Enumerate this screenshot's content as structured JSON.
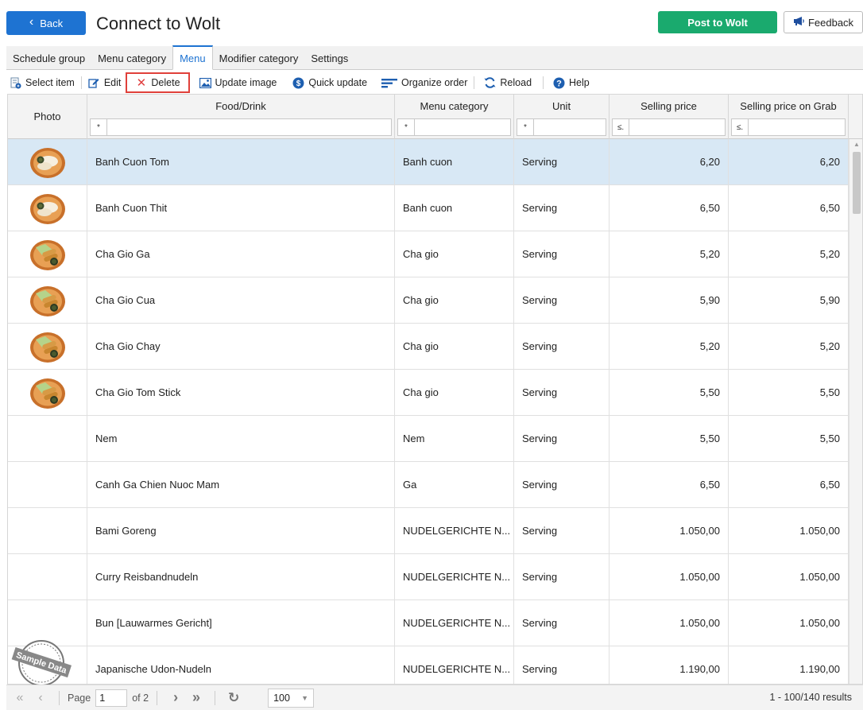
{
  "header": {
    "back_label": "Back",
    "title": "Connect to Wolt",
    "post_label": "Post to Wolt",
    "feedback_label": "Feedback"
  },
  "tabs": [
    {
      "label": "Schedule group",
      "active": false
    },
    {
      "label": "Menu category",
      "active": false
    },
    {
      "label": "Menu",
      "active": true
    },
    {
      "label": "Modifier category",
      "active": false
    },
    {
      "label": "Settings",
      "active": false
    }
  ],
  "toolbar": {
    "select_item": "Select item",
    "edit": "Edit",
    "delete": "Delete",
    "update_image": "Update image",
    "quick_update": "Quick update",
    "organize_order": "Organize order",
    "reload": "Reload",
    "help": "Help"
  },
  "columns": {
    "photo": "Photo",
    "food": "Food/Drink",
    "category": "Menu category",
    "unit": "Unit",
    "price": "Selling price",
    "price_grab": "Selling price on Grab"
  },
  "filters": {
    "food_op": "*",
    "category_op": "*",
    "unit_op": "*",
    "price_op": "≤.",
    "price_grab_op": "≤."
  },
  "rows": [
    {
      "food": "Banh Cuon Tom",
      "category": "Banh cuon",
      "unit": "Serving",
      "price": "6,20",
      "price_grab": "6,20",
      "photo": true,
      "selected": true
    },
    {
      "food": "Banh Cuon Thit",
      "category": "Banh cuon",
      "unit": "Serving",
      "price": "6,50",
      "price_grab": "6,50",
      "photo": true,
      "selected": false
    },
    {
      "food": "Cha Gio Ga",
      "category": "Cha gio",
      "unit": "Serving",
      "price": "5,20",
      "price_grab": "5,20",
      "photo": true,
      "selected": false
    },
    {
      "food": "Cha Gio Cua",
      "category": "Cha gio",
      "unit": "Serving",
      "price": "5,90",
      "price_grab": "5,90",
      "photo": true,
      "selected": false
    },
    {
      "food": "Cha Gio Chay",
      "category": "Cha gio",
      "unit": "Serving",
      "price": "5,20",
      "price_grab": "5,20",
      "photo": true,
      "selected": false
    },
    {
      "food": "Cha Gio Tom Stick",
      "category": "Cha gio",
      "unit": "Serving",
      "price": "5,50",
      "price_grab": "5,50",
      "photo": true,
      "selected": false
    },
    {
      "food": "Nem",
      "category": "Nem",
      "unit": "Serving",
      "price": "5,50",
      "price_grab": "5,50",
      "photo": false,
      "selected": false
    },
    {
      "food": "Canh Ga Chien Nuoc Mam",
      "category": "Ga",
      "unit": "Serving",
      "price": "6,50",
      "price_grab": "6,50",
      "photo": false,
      "selected": false
    },
    {
      "food": "Bami Goreng",
      "category": "NUDELGERICHTE N...",
      "unit": "Serving",
      "price": "1.050,00",
      "price_grab": "1.050,00",
      "photo": false,
      "selected": false
    },
    {
      "food": "Curry Reisbandnudeln",
      "category": "NUDELGERICHTE N...",
      "unit": "Serving",
      "price": "1.050,00",
      "price_grab": "1.050,00",
      "photo": false,
      "selected": false
    },
    {
      "food": "Bun [Lauwarmes Gericht]",
      "category": "NUDELGERICHTE N...",
      "unit": "Serving",
      "price": "1.050,00",
      "price_grab": "1.050,00",
      "photo": false,
      "selected": false
    },
    {
      "food": "Japanische Udon-Nudeln",
      "category": "NUDELGERICHTE N...",
      "unit": "Serving",
      "price": "1.190,00",
      "price_grab": "1.190,00",
      "photo": false,
      "selected": false
    }
  ],
  "pager": {
    "page_label": "Page",
    "page_value": "1",
    "of_label": "of 2",
    "page_size": "100",
    "results": "1 - 100/140 results"
  },
  "stamp_text": "Sample Data",
  "colors": {
    "accent": "#1e73d2",
    "post": "#1aaa6e",
    "highlight": "#e0403a",
    "selected_row": "#d8e8f5"
  }
}
